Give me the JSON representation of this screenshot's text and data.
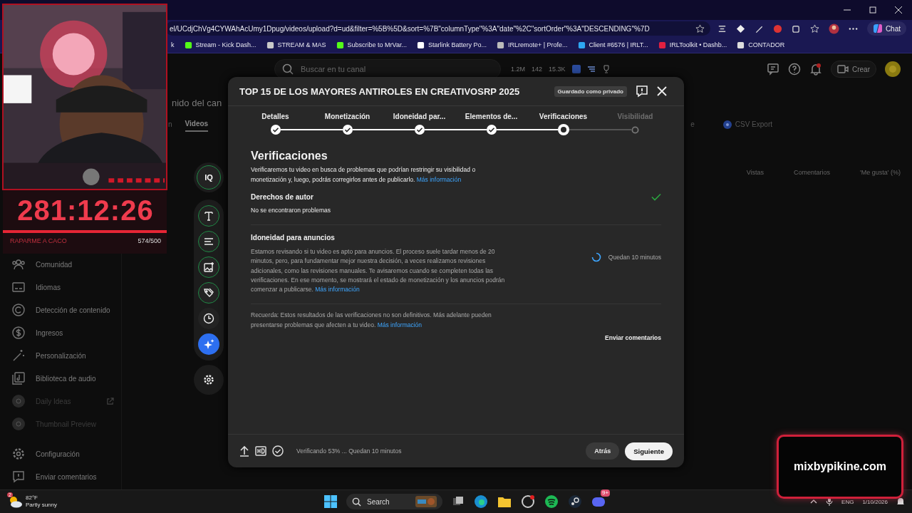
{
  "browser": {
    "url": "el/UCdjChVg4CYWAhAcUmy1Dpug/videos/upload?d=ud&filter=%5B%5D&sort=%7B\"columnType\"%3A\"date\"%2C\"sortOrder\"%3A\"DESCENDING\"%7D",
    "chat_label": "Chat",
    "bookmarks": [
      {
        "label": "k"
      },
      {
        "label": "Stream - Kick Dash..."
      },
      {
        "label": "STREAM & MAS"
      },
      {
        "label": "Subscribe to MrVar..."
      },
      {
        "label": "Starlink Battery Po..."
      },
      {
        "label": "IRLremote+ | Profe..."
      },
      {
        "label": "Client #6576 | IRLT..."
      },
      {
        "label": "IRLToolkit • Dashb..."
      },
      {
        "label": "CONTADOR"
      }
    ]
  },
  "studio": {
    "search_placeholder": "Buscar en tu canal",
    "stats": [
      "1.2M",
      "142",
      "15.3K"
    ],
    "create_label": "Crear",
    "page_title": "nido del can",
    "tabs": [
      {
        "label": "n",
        "selected": false
      },
      {
        "label": "Videos",
        "selected": true
      }
    ],
    "tab_partial": "e",
    "csv_export": "CSV Export",
    "columns": [
      "Vistas",
      "Comentarios",
      "'Me gusta' (%)"
    ]
  },
  "sidebar": {
    "items": [
      {
        "label": "Comunidad",
        "kind": "nav",
        "external": false
      },
      {
        "label": "Idiomas",
        "kind": "nav",
        "external": false
      },
      {
        "label": "Detección de contenido",
        "kind": "nav",
        "external": false
      },
      {
        "label": "Ingresos",
        "kind": "nav",
        "external": false
      },
      {
        "label": "Personalización",
        "kind": "nav",
        "external": false
      },
      {
        "label": "Biblioteca de audio",
        "kind": "nav",
        "external": false
      },
      {
        "label": "Daily Ideas",
        "kind": "extension",
        "external": true
      },
      {
        "label": "Thumbnail Preview",
        "kind": "extension",
        "external": false
      }
    ],
    "footer_items": [
      {
        "label": "Configuración"
      },
      {
        "label": "Enviar comentarios"
      }
    ]
  },
  "stream_overlay": {
    "timer": "281:12:26",
    "goal_label": "RAPARME A CACO",
    "goal_count": "574/500"
  },
  "side_toolbar": {
    "badge": "IQ",
    "tools": [
      {
        "selected": false
      },
      {
        "selected": false
      },
      {
        "selected": false
      },
      {
        "selected": false
      },
      {
        "selected": false
      },
      {
        "selected": true
      }
    ]
  },
  "dialog": {
    "title": "TOP 15 DE LOS MAYORES ANTIROLES EN CREATIVOSRP 2025",
    "saved_badge": "Guardado como privado",
    "steps": [
      {
        "label": "Detalles",
        "completed": true,
        "selected": false
      },
      {
        "label": "Monetización",
        "completed": true,
        "selected": false
      },
      {
        "label": "Idoneidad par...",
        "completed": true,
        "selected": false
      },
      {
        "label": "Elementos de...",
        "completed": true,
        "selected": false
      },
      {
        "label": "Verificaciones",
        "completed": false,
        "selected": true
      },
      {
        "label": "Visibilidad",
        "completed": false,
        "selected": false
      }
    ],
    "heading": "Verificaciones",
    "intro": {
      "text": "Verificaremos tu video en busca de problemas que podrían restringir su visibilidad o monetización y, luego, podrás corregirlos antes de publicarlo.",
      "link": "Más información"
    },
    "checks": [
      {
        "title": "Derechos de autor",
        "complete": true,
        "status_text": "No se encontraron problemas"
      },
      {
        "title": "Idoneidad para anuncios",
        "complete": false,
        "body": "Estamos revisando si tu video es apto para anuncios. El proceso suele tardar menos de 20 minutos, pero, para fundamentar mejor nuestra decisión, a veces realizamos revisiones adicionales, como las revisiones manuales. Te avisaremos cuando se completen todas las verificaciones. En ese momento, se mostrará el estado de monetización y los anuncios podrán comenzar a publicarse.",
        "link": "Más información",
        "status_text": "Quedan 10 minutos"
      }
    ],
    "note": {
      "text": "Recuerda: Estos resultados de las verificaciones no son definitivos. Más adelante pueden presentarse problemas que afecten a tu video.",
      "link": "Más información"
    },
    "feedback": "Enviar comentarios",
    "footer_status": "Verificando 53% ... Quedan 10 minutos",
    "back": "Atrás",
    "next": "Siguiente"
  },
  "branding": {
    "text": "mixbypikine.com"
  },
  "taskbar": {
    "weather_badge": "2",
    "temperature": "82°F",
    "weather": "Partly sunny",
    "search_label": "Search",
    "notification_badge": "9+",
    "language": "ENG",
    "date": "1/10/2026"
  }
}
